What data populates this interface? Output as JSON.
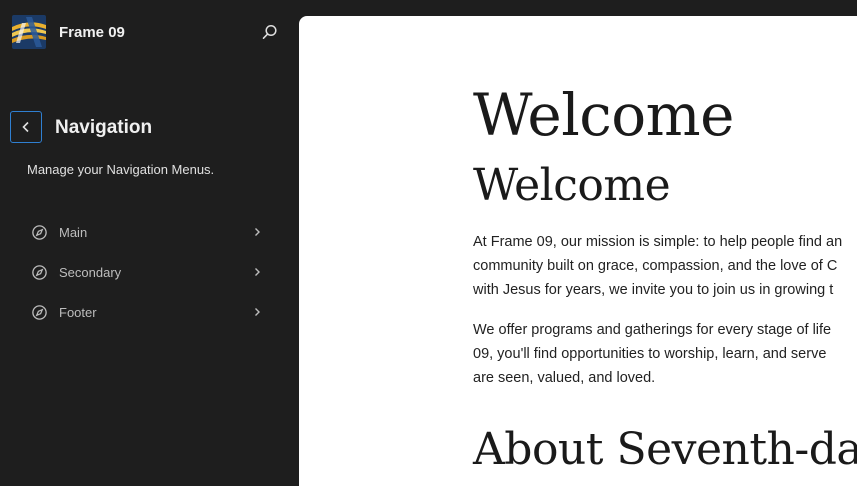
{
  "site": {
    "title": "Frame 09",
    "icon": "site-logo-icon",
    "search_icon": "search-icon"
  },
  "navigation_panel": {
    "title": "Navigation",
    "description": "Manage your Navigation Menus.",
    "back_icon": "chevron-left-icon",
    "menus": [
      {
        "label": "Main",
        "icon": "compass-icon",
        "chevron": "chevron-right-icon"
      },
      {
        "label": "Secondary",
        "icon": "compass-icon",
        "chevron": "chevron-right-icon"
      },
      {
        "label": "Footer",
        "icon": "compass-icon",
        "chevron": "chevron-right-icon"
      }
    ]
  },
  "preview": {
    "heading_1": "Welcome",
    "heading_2": "Welcome",
    "paragraph_1": [
      "At Frame 09, our mission is simple: to help people find an",
      "community built on grace, compassion, and the love of C",
      "with Jesus for years, we invite you to join us in growing t"
    ],
    "paragraph_2": [
      "We offer programs and gatherings for every stage of life",
      "09, you'll find opportunities to worship, learn, and serve",
      "are seen, valued, and loved."
    ],
    "heading_3": "About Seventh-da"
  },
  "colors": {
    "sidebar_bg": "#1e1e1e",
    "canvas_bg": "#ffffff",
    "accent": "#2f7fd1",
    "text_light": "#e0e0e0",
    "text_muted": "#bdbdbd"
  }
}
